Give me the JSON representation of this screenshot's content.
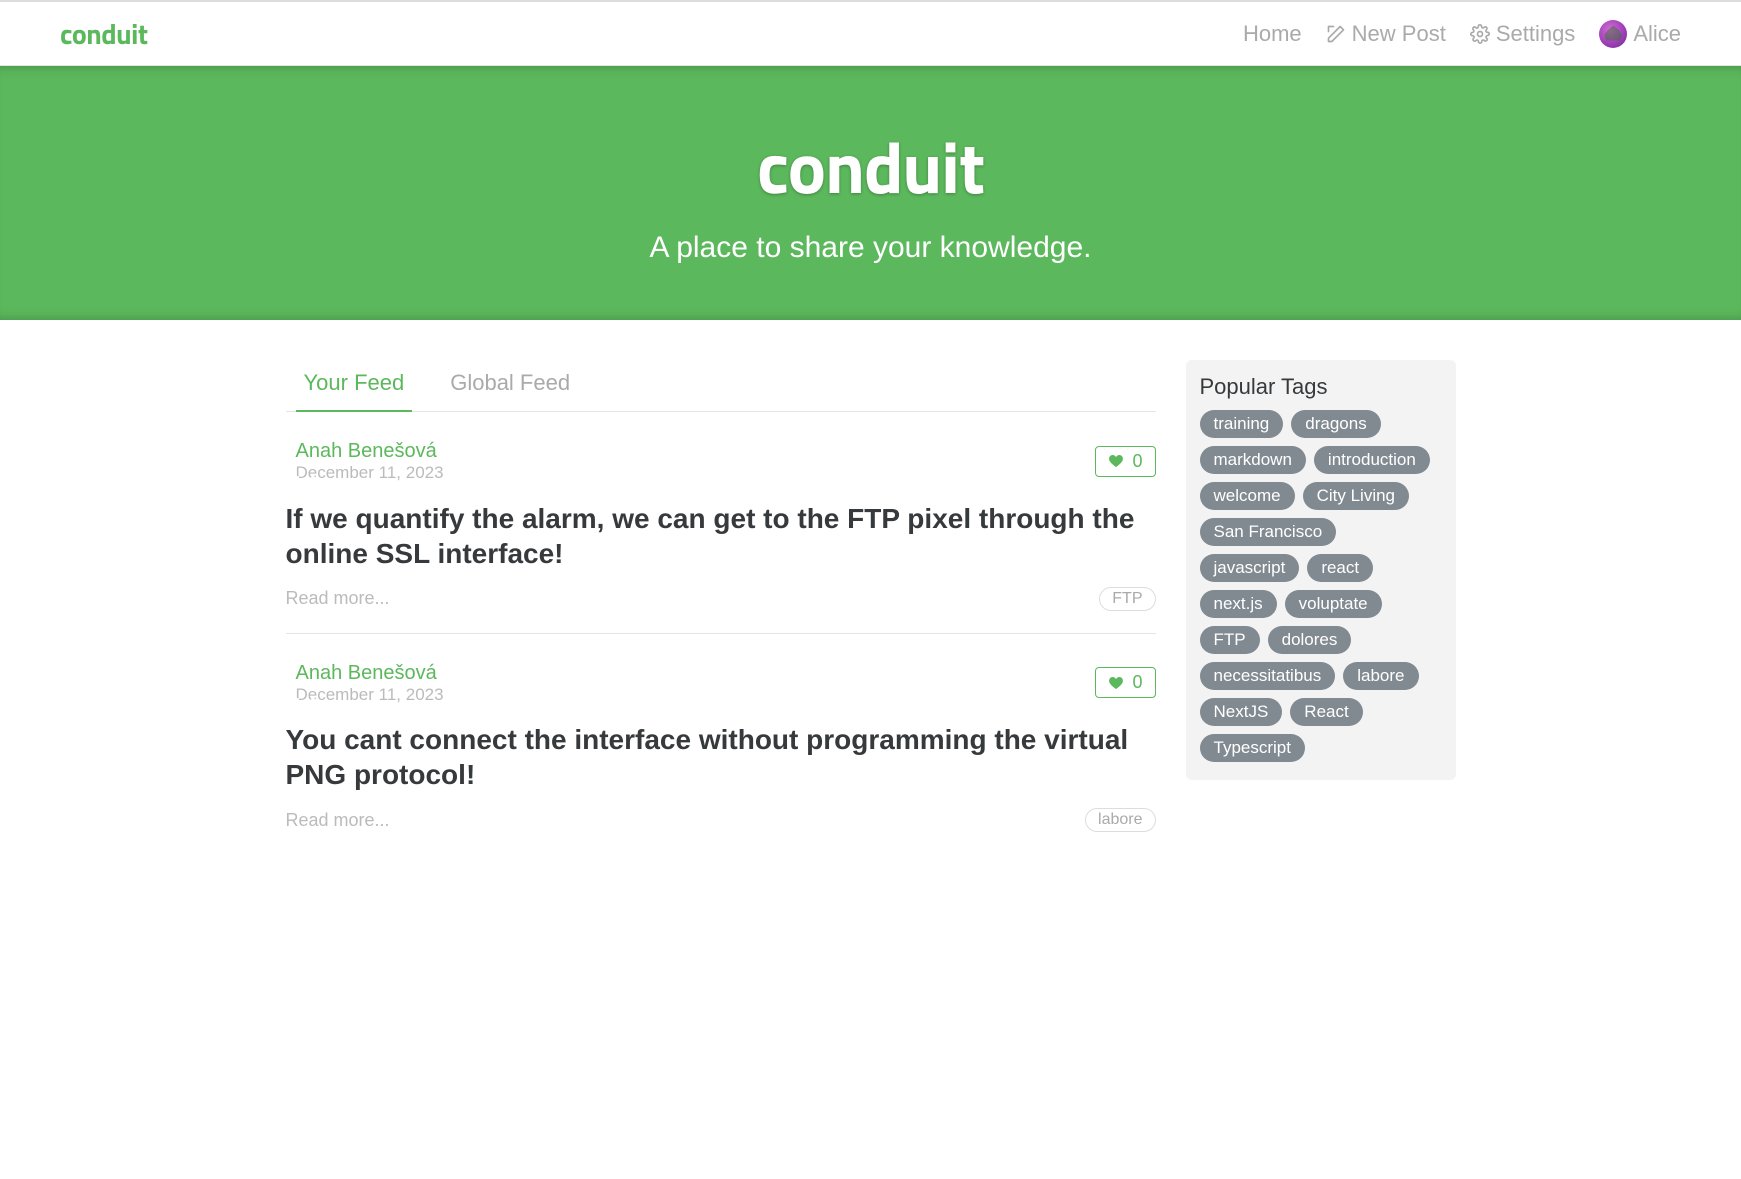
{
  "nav": {
    "brand": "conduit",
    "home": "Home",
    "newPost": "New Post",
    "settings": "Settings",
    "user": "Alice"
  },
  "banner": {
    "title": "conduit",
    "subtitle": "A place to share your knowledge."
  },
  "tabs": {
    "yourFeed": "Your Feed",
    "globalFeed": "Global Feed"
  },
  "articles": [
    {
      "author": "Anah Benešová",
      "date": "December 11, 2023",
      "likes": "0",
      "title": "If we quantify the alarm, we can get to the FTP pixel through the online SSL interface!",
      "readMore": "Read more...",
      "tags": [
        "FTP"
      ]
    },
    {
      "author": "Anah Benešová",
      "date": "December 11, 2023",
      "likes": "0",
      "title": "You cant connect the interface without programming the virtual PNG protocol!",
      "readMore": "Read more...",
      "tags": [
        "labore"
      ]
    }
  ],
  "sidebar": {
    "title": "Popular Tags",
    "tags": [
      "training",
      "dragons",
      "markdown",
      "introduction",
      "welcome",
      "City Living",
      "San Francisco",
      "javascript",
      "react",
      "next.js",
      "voluptate",
      "FTP",
      "dolores",
      "necessitatibus",
      "labore",
      "NextJS",
      "React",
      "Typescript"
    ]
  }
}
